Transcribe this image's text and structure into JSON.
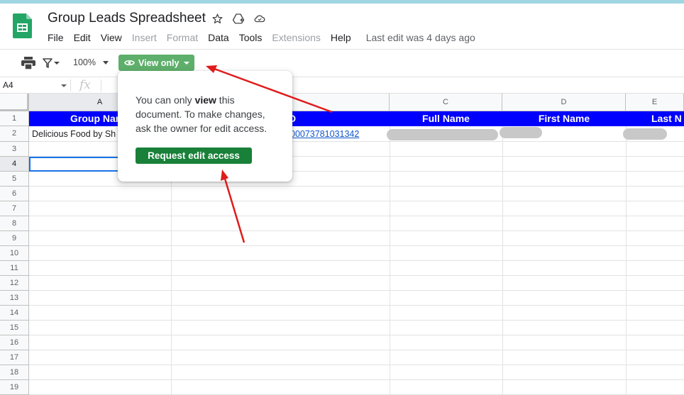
{
  "app": {
    "title": "Group Leads Spreadsheet",
    "last_edit": "Last edit was 4 days ago"
  },
  "menu": {
    "items": [
      {
        "label": "File",
        "enabled": true
      },
      {
        "label": "Edit",
        "enabled": true
      },
      {
        "label": "View",
        "enabled": true
      },
      {
        "label": "Insert",
        "enabled": false
      },
      {
        "label": "Format",
        "enabled": false
      },
      {
        "label": "Data",
        "enabled": true
      },
      {
        "label": "Tools",
        "enabled": true
      },
      {
        "label": "Extensions",
        "enabled": false
      },
      {
        "label": "Help",
        "enabled": true
      }
    ]
  },
  "toolbar": {
    "zoom": "100%",
    "view_mode_label": "View only",
    "icons": [
      "print-icon",
      "filter-icon",
      "eye-icon"
    ]
  },
  "formula_bar": {
    "cell_ref": "A4",
    "fx_label": "fx"
  },
  "grid": {
    "columns": [
      "A",
      "",
      "C",
      "D",
      "E"
    ],
    "row_numbers": [
      "1",
      "2",
      "3",
      "4",
      "5",
      "6",
      "7",
      "8",
      "9",
      "10",
      "11",
      "12",
      "13",
      "14",
      "15",
      "16",
      "17",
      "18",
      "19"
    ],
    "header_row": {
      "a": "Group Nar",
      "b": "D",
      "c": "Full Name",
      "d": "First Name",
      "e": "Last N"
    },
    "row2": {
      "a": "Delicious Food by Sh",
      "b_link": "00073781031342"
    },
    "selected_cell": "A4"
  },
  "popover": {
    "text_prefix": "You can only ",
    "text_bold": "view",
    "text_suffix": " this document. To make changes, ask the owner for edit access.",
    "button_label": "Request edit access"
  },
  "colors": {
    "header_fill": "#0000ff",
    "view_only_button": "#5eaf6b",
    "request_button": "#188038",
    "annotation_arrow": "#e01b1b"
  }
}
